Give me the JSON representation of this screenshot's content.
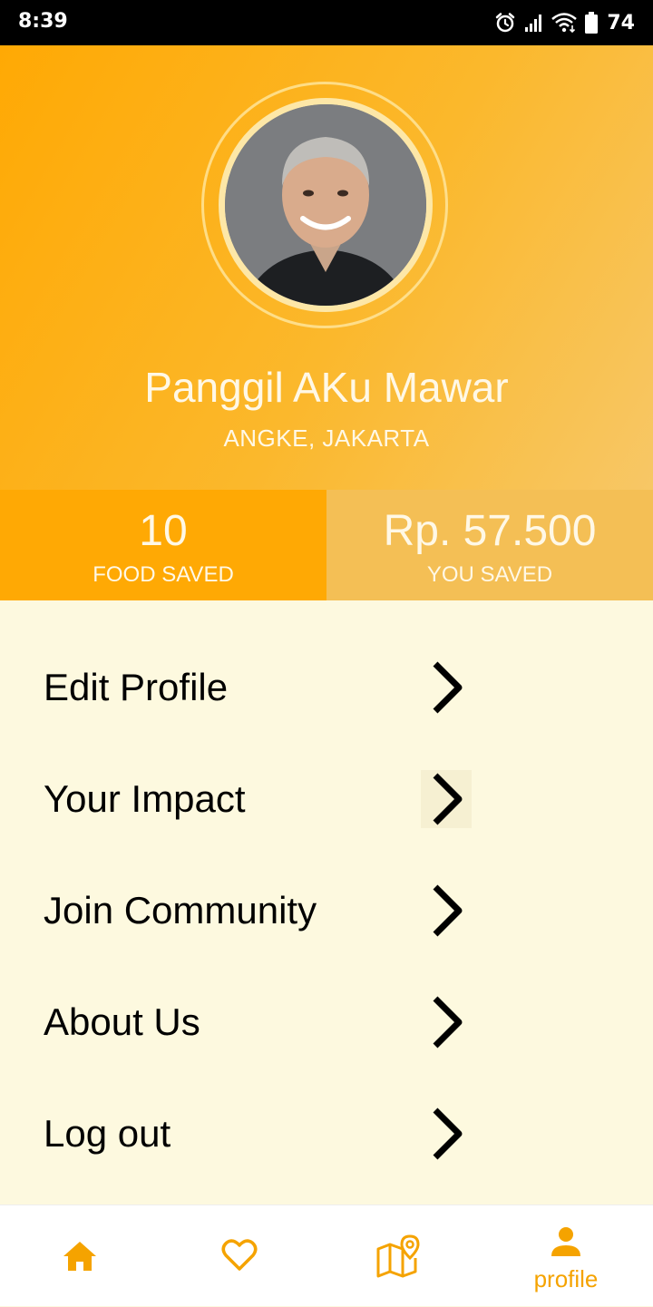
{
  "status_bar": {
    "time": "8:39",
    "battery": "74",
    "icons": [
      "alarm-icon",
      "signal-icon",
      "wifi-icon",
      "battery-icon"
    ]
  },
  "profile": {
    "name": "Panggil AKu Mawar",
    "location": "ANGKE, JAKARTA"
  },
  "stats": [
    {
      "value": "10",
      "label": "FOOD SAVED"
    },
    {
      "value": "Rp. 57.500",
      "label": "YOU SAVED"
    }
  ],
  "menu": {
    "items": [
      {
        "label": "Edit Profile"
      },
      {
        "label": "Your Impact"
      },
      {
        "label": "Join Community"
      },
      {
        "label": "About Us"
      },
      {
        "label": "Log out"
      }
    ]
  },
  "bottom_nav": {
    "items": [
      {
        "icon": "home-icon"
      },
      {
        "icon": "heart-icon"
      },
      {
        "icon": "map-icon"
      },
      {
        "icon": "person-icon",
        "label": "profile",
        "active": true
      }
    ]
  },
  "colors": {
    "accent": "#FFA904",
    "accent_light": "#F4BF55",
    "background": "#FDF9DF",
    "nav_accent": "#F5A300"
  }
}
